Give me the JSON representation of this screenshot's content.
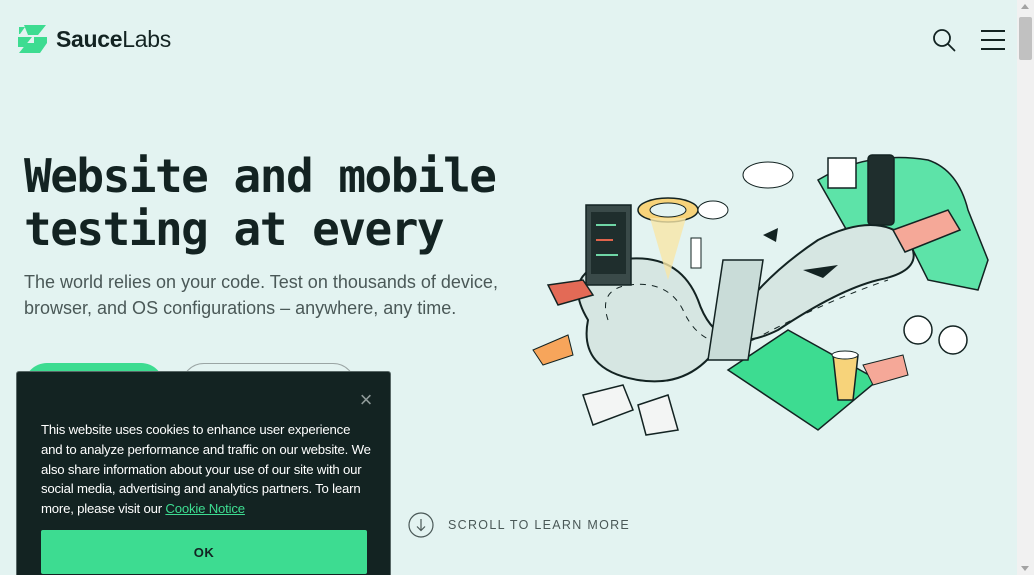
{
  "header": {
    "logo_text_bold": "Sauce",
    "logo_text_light": "Labs",
    "search_icon": "search-icon",
    "menu_icon": "hamburger-menu-icon"
  },
  "hero": {
    "title": "Website and mobile\ntesting at every",
    "subtitle": "The world relies on your code. Test on thousands of device, browser, and OS configurations – anywhere, any time.",
    "primary_cta_label": "",
    "secondary_cta_label": ""
  },
  "scroll_hint": {
    "label": "SCROLL TO LEARN MORE",
    "icon": "arrow-down-circle-icon"
  },
  "cookie_banner": {
    "text": "This website uses cookies to enhance user experience and to analyze performance and traffic on our website. We also share information about your use of our site with our social media, advertising and analytics partners. To learn more, please visit our ",
    "link_text": "Cookie Notice",
    "ok_label": "OK",
    "close_glyph": "×"
  },
  "colors": {
    "background": "#e3f3f1",
    "brand_green": "#3ddc91",
    "dark": "#132322"
  }
}
